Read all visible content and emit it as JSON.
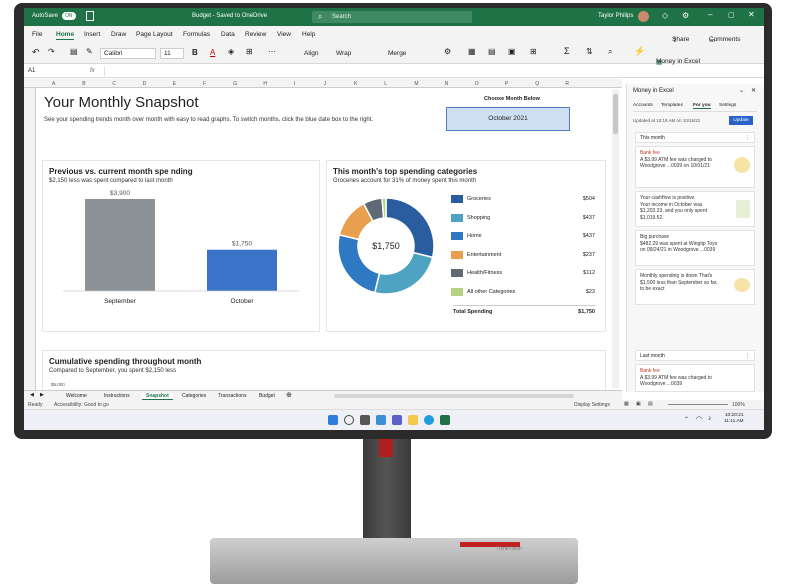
{
  "window": {
    "autosave_label": "AutoSave",
    "autosave_state": "ON",
    "doc_title": "Budget - Saved to OneDrive",
    "search_placeholder": "Search",
    "user_name": "Taylor Philips"
  },
  "menu_tabs": [
    "File",
    "Home",
    "Insert",
    "Draw",
    "Page Layout",
    "Formulas",
    "Data",
    "Review",
    "View",
    "Help"
  ],
  "share_label": "Share",
  "comments_label": "Comments",
  "ribbon": {
    "font_name": "Calibri",
    "font_size": "11",
    "align_label": "Align",
    "wrap_label": "Wrap",
    "merge_label": "Merge",
    "money_label": "Money in Excel"
  },
  "formula_bar": {
    "cell_ref": "A1",
    "fx": "fx"
  },
  "columns": [
    "A",
    "B",
    "C",
    "D",
    "E",
    "F",
    "G",
    "H",
    "I",
    "J",
    "K",
    "L",
    "M",
    "N",
    "O",
    "P",
    "Q",
    "R"
  ],
  "snapshot": {
    "title": "Your Monthly Snapshot",
    "subtitle": "See your spending trends month over month with easy to read graphs. To switch months, click the blue date box to the right.",
    "choose_label": "Choose Month Below",
    "month_value": "October 2021"
  },
  "prev_vs_current": {
    "title": "Previous vs. current month spe nding",
    "subtitle": "$2,150 less was spent compared to last month"
  },
  "top_categories": {
    "title": "This month's top spending categories",
    "subtitle": "Groceries account for 31% of money spent this month",
    "center_label": "$1,750",
    "total_label": "Total Spending",
    "total_value": "$1,750"
  },
  "cumulative": {
    "title": "Cumulative spending throughout month",
    "subtitle": "Compared to September, you spent $2,150 less",
    "axis_top": "$5,000"
  },
  "chart_data": [
    {
      "type": "bar",
      "categories": [
        "September",
        "October"
      ],
      "values": [
        3900,
        1750
      ],
      "data_labels": [
        "$3,900",
        "$1,750"
      ],
      "colors": [
        "#8c9196",
        "#3b73c8"
      ]
    },
    {
      "type": "pie",
      "categories": [
        "Groceries",
        "Shopping",
        "Home",
        "Entertainment",
        "Health/Fitness",
        "All other Categories"
      ],
      "values": [
        504,
        437,
        437,
        237,
        112,
        23
      ],
      "value_labels": [
        "$504",
        "$437",
        "$437",
        "$237",
        "$112",
        "$23"
      ],
      "colors": [
        "#2a5d9f",
        "#4ea3c3",
        "#2f78c4",
        "#e8a04e",
        "#5e6b77",
        "#b6d17f"
      ]
    }
  ],
  "sheet_tabs": [
    "Welcome",
    "Instructions",
    "Snapshot",
    "Categories",
    "Transactions",
    "Budget"
  ],
  "active_sheet": "Snapshot",
  "status": {
    "ready": "Ready",
    "accessibility": "Accessibility: Good to go",
    "display_settings": "Display Settings",
    "zoom": "100%"
  },
  "money_pane": {
    "title": "Money in Excel",
    "tabs": [
      "Accounts",
      "Templates",
      "For you",
      "Settings"
    ],
    "updated": "Updated at 10:19 AM on 10/15/21",
    "update_btn": "Update",
    "this_month": "This month",
    "last_month": "Last month",
    "cards": [
      {
        "head": "Bank fee",
        "body": "A $3.99 ATM fee was charged to Woodgrove ...0039 on 10/01/21"
      },
      {
        "head": "Your cashflow is positive",
        "body": "Your income in October was $1,203.33, and you only spent $1,019.52."
      },
      {
        "head": "Big purchase",
        "body": "$482.29 was spent at Wingtip Toys on 09/24/21 in Woodgrove ...0039"
      },
      {
        "head": "",
        "body": "Monthly spending is down That's $1,500 less than September so far, to be exact"
      },
      {
        "head": "Bank fee",
        "body": "A $3.99 ATM fee was charged to Woodgrove ...0039"
      }
    ]
  },
  "clock": {
    "time": "10:20:21",
    "date": "11:11 AM"
  },
  "stand_brand": "ThinkVision",
  "colors": {
    "excel_green": "#1f7246",
    "accent_blue": "#3b73c8",
    "date_box": "#cfe0f3"
  }
}
